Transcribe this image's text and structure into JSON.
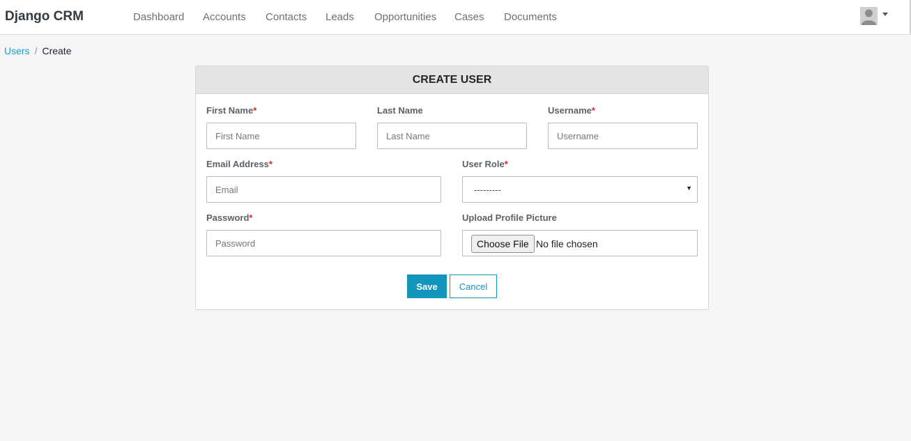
{
  "navbar": {
    "brand": "Django CRM",
    "items": [
      {
        "label": "Dashboard"
      },
      {
        "label": "Accounts"
      },
      {
        "label": "Contacts"
      },
      {
        "label": "Leads"
      },
      {
        "label": "Opportunities"
      },
      {
        "label": "Cases"
      },
      {
        "label": "Documents"
      }
    ],
    "user_menu_icon": "avatar-icon"
  },
  "breadcrumb": {
    "parent": "Users",
    "separator": "/",
    "current": "Create"
  },
  "form": {
    "title": "CREATE USER",
    "required_marker": "*",
    "first_name": {
      "label": "First Name",
      "placeholder": "First Name",
      "value": ""
    },
    "last_name": {
      "label": "Last Name",
      "placeholder": "Last Name",
      "value": ""
    },
    "username": {
      "label": "Username",
      "placeholder": "Username",
      "value": ""
    },
    "email": {
      "label": "Email Address",
      "placeholder": "Email",
      "value": ""
    },
    "user_role": {
      "label": "User Role",
      "selected": "---------"
    },
    "password": {
      "label": "Password",
      "placeholder": "Password",
      "value": ""
    },
    "profile_picture": {
      "label": "Upload Profile Picture",
      "button": "Choose File",
      "status": "No file chosen"
    },
    "save_label": "Save",
    "cancel_label": "Cancel"
  },
  "colors": {
    "accent": "#1395be",
    "link": "#1a9ec4",
    "required": "#d9232d",
    "background": "#f6f6f8"
  }
}
